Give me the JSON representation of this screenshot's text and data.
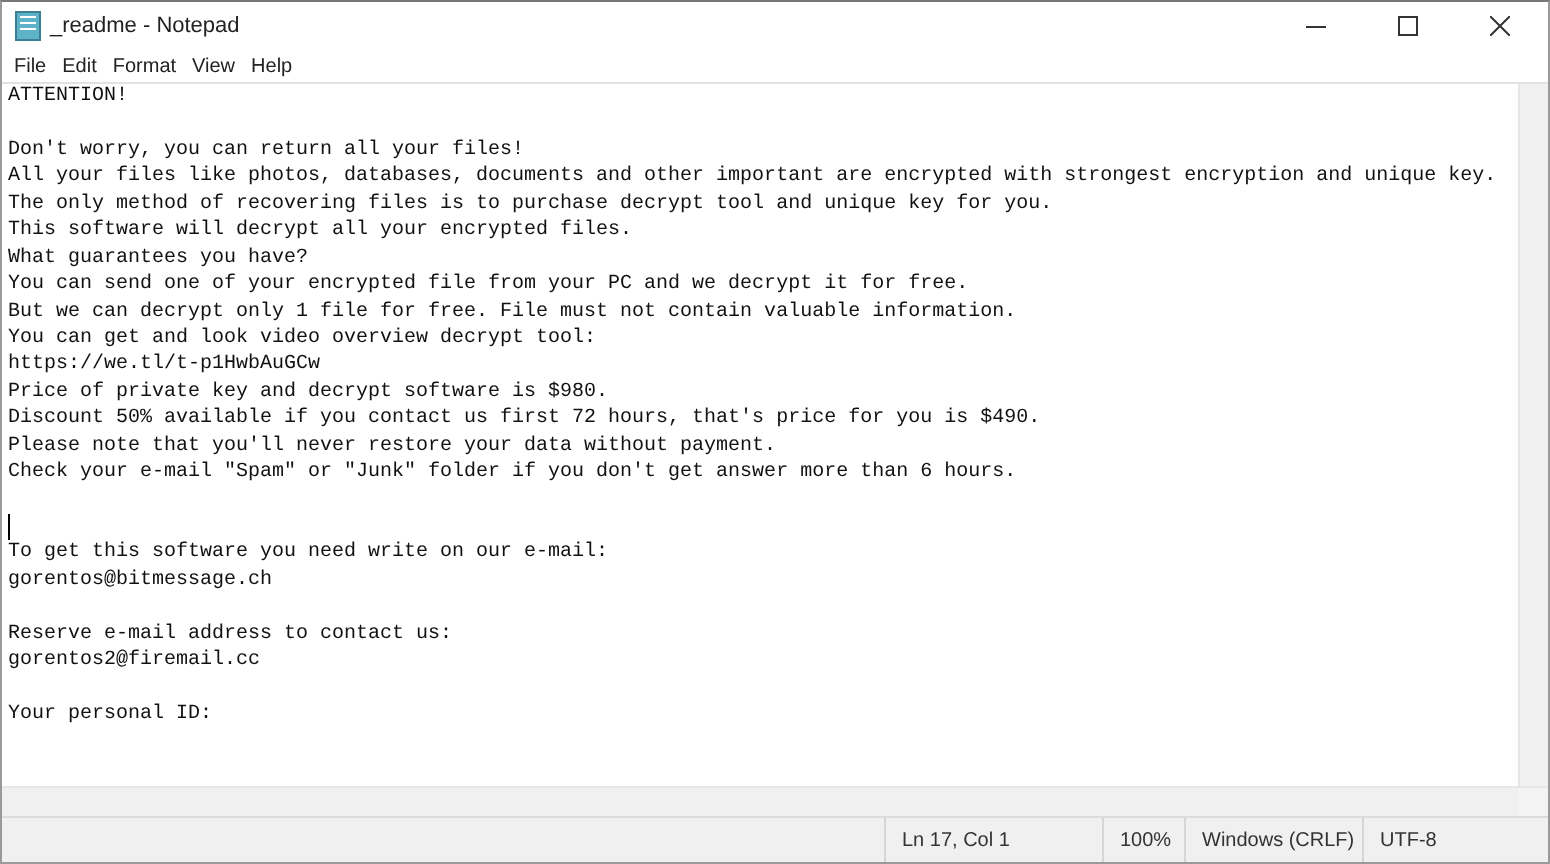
{
  "window": {
    "title": "_readme - Notepad"
  },
  "menu": [
    "File",
    "Edit",
    "Format",
    "View",
    "Help"
  ],
  "editor": {
    "lines": [
      {
        "kind": "text",
        "text": "ATTENTION!"
      },
      {
        "kind": "blank"
      },
      {
        "kind": "text",
        "text": "Don't worry, you can return all your files!"
      },
      {
        "kind": "text",
        "text": "All your files like photos, databases, documents and other important are encrypted with strongest encryption and unique key."
      },
      {
        "kind": "text",
        "text": "The only method of recovering files is to purchase decrypt tool and unique key for you."
      },
      {
        "kind": "text",
        "text": "This software will decrypt all your encrypted files."
      },
      {
        "kind": "text",
        "text": "What guarantees you have?"
      },
      {
        "kind": "text",
        "text": "You can send one of your encrypted file from your PC and we decrypt it for free."
      },
      {
        "kind": "text",
        "text": "But we can decrypt only 1 file for free. File must not contain valuable information."
      },
      {
        "kind": "text",
        "text": "You can get and look video overview decrypt tool:"
      },
      {
        "kind": "text",
        "text": "https://we.tl/t-p1HwbAuGCw"
      },
      {
        "kind": "text",
        "text": "Price of private key and decrypt software is $980."
      },
      {
        "kind": "text",
        "text": "Discount 50% available if you contact us first 72 hours, that's price for you is $490."
      },
      {
        "kind": "text",
        "text": "Please note that you'll never restore your data without payment."
      },
      {
        "kind": "text",
        "text": "Check your e-mail \"Spam\" or \"Junk\" folder if you don't get answer more than 6 hours."
      },
      {
        "kind": "blank"
      },
      {
        "kind": "caret"
      },
      {
        "kind": "text",
        "text": "To get this software you need write on our e-mail:"
      },
      {
        "kind": "text",
        "text": "gorentos@bitmessage.ch"
      },
      {
        "kind": "blank"
      },
      {
        "kind": "text",
        "text": "Reserve e-mail address to contact us:"
      },
      {
        "kind": "text",
        "text": "gorentos2@firemail.cc"
      },
      {
        "kind": "blank"
      },
      {
        "kind": "text",
        "text": "Your personal ID:"
      }
    ]
  },
  "status_bar": [
    "Ln 17, Col 1",
    "100%",
    "Windows (CRLF)",
    "UTF-8"
  ]
}
